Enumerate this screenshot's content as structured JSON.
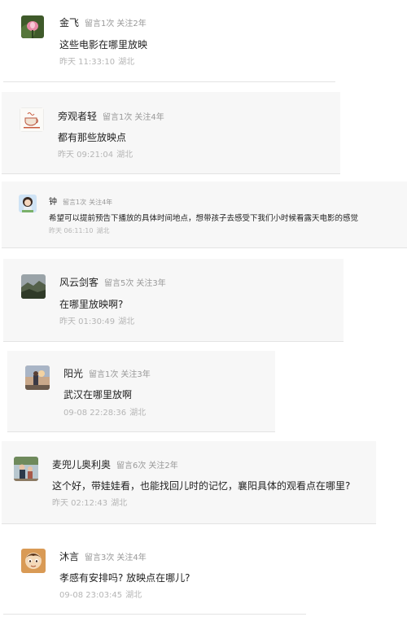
{
  "comments": [
    {
      "user": "金飞",
      "messages": "留言1次",
      "follow": "关注2年",
      "content": "这些电影在哪里放映",
      "time": "昨天 11:33:10",
      "location": "湖北",
      "avatar_icon": "avatar-lotus-icon"
    },
    {
      "user": "旁观者轻",
      "messages": "留言1次",
      "follow": "关注4年",
      "content": "都有那些放映点",
      "time": "昨天 09:21:04",
      "location": "湖北",
      "avatar_icon": "avatar-teacup-icon"
    },
    {
      "user": "钟",
      "messages": "留言1次",
      "follow": "关注4年",
      "content": "希望可以提前预告下播放的具体时间地点，想带孩子去感受下我们小时候看露天电影的感觉",
      "time": "昨天 06:11:10",
      "location": "湖北",
      "avatar_icon": "avatar-cartoon-girl-icon"
    },
    {
      "user": "风云剑客",
      "messages": "留言5次",
      "follow": "关注3年",
      "content": "在哪里放映啊?",
      "time": "昨天 01:30:49",
      "location": "湖北",
      "avatar_icon": "avatar-landscape-icon"
    },
    {
      "user": "阳光",
      "messages": "留言1次",
      "follow": "关注3年",
      "content": "武汉在哪里放啊",
      "time": "09-08 22:28:36",
      "location": "湖北",
      "avatar_icon": "avatar-sunset-icon"
    },
    {
      "user": "麦兜儿奥利奥",
      "messages": "留言6次",
      "follow": "关注2年",
      "content": "这个好，带娃娃看，也能找回儿时的记忆，襄阳具体的观看点在哪里?",
      "time": "昨天 02:12:43",
      "location": "湖北",
      "avatar_icon": "avatar-family-icon"
    },
    {
      "user": "沐言",
      "messages": "留言3次",
      "follow": "关注4年",
      "content": "孝感有安排吗? 放映点在哪儿?",
      "time": "09-08 23:03:45",
      "location": "湖北",
      "avatar_icon": "avatar-cartoon-icon"
    }
  ]
}
